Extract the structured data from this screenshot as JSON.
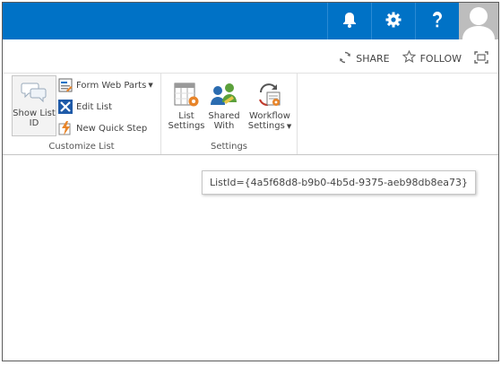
{
  "actions": {
    "share_label": "SHARE",
    "follow_label": "FOLLOW"
  },
  "ribbon": {
    "customize_group_label": "Customize List",
    "settings_group_label": "Settings",
    "show_list_id": {
      "line1": "Show List",
      "line2": "ID"
    },
    "form_web_parts_label": "Form Web Parts",
    "edit_list_label": "Edit List",
    "new_quick_step_label": "New Quick Step",
    "list_settings": {
      "line1": "List",
      "line2": "Settings"
    },
    "shared_with": {
      "line1": "Shared",
      "line2": "With"
    },
    "workflow_settings": {
      "line1": "Workflow",
      "line2": "Settings"
    }
  },
  "tooltip": {
    "text": "ListId={4a5f68d8-b9b0-4b5d-9375-aeb98db8ea73}"
  },
  "icons": {
    "notifications": "bell-icon",
    "settings": "gear-icon",
    "help": "question-icon",
    "avatar": "user-silhouette-icon",
    "share": "sync-arrows-icon",
    "follow": "star-outline-icon",
    "focus": "focus-mode-icon"
  },
  "colors": {
    "suite_bar": "#0072c6",
    "accent_orange": "#e8852a"
  }
}
